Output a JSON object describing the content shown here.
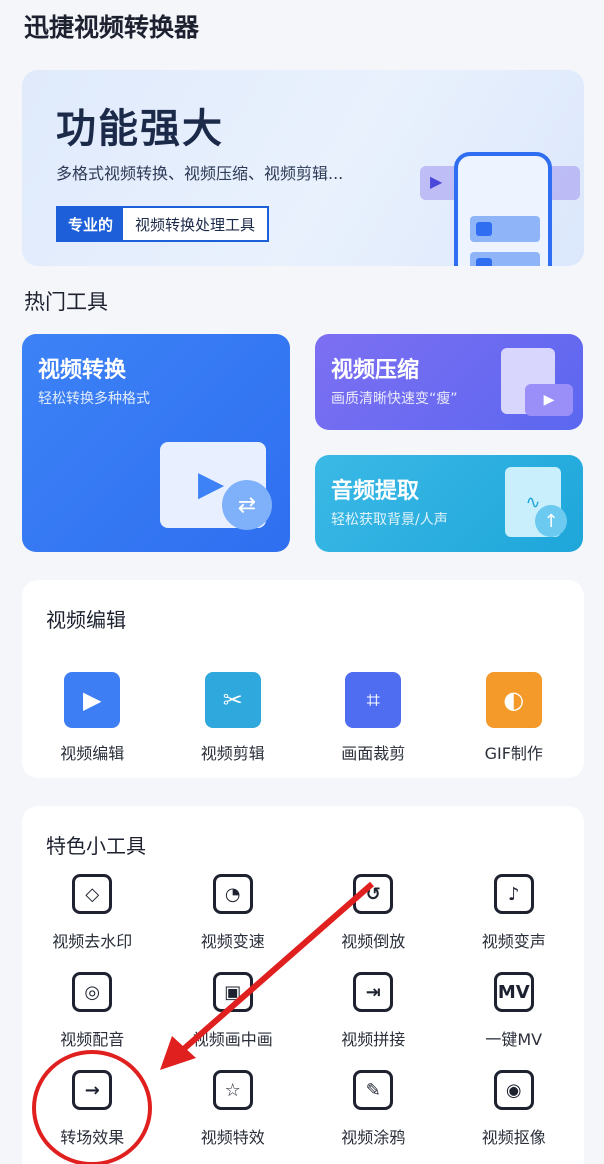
{
  "app": {
    "title": "迅捷视频转换器"
  },
  "banner": {
    "headline": "功能强大",
    "subtitle": "多格式视频转换、视频压缩、视频剪辑...",
    "tag_highlight": "专业的",
    "tag_text": "视频转换处理工具"
  },
  "hot_tools": {
    "title": "热门工具",
    "convert": {
      "title": "视频转换",
      "subtitle": "轻松转换多种格式"
    },
    "compress": {
      "title": "视频压缩",
      "subtitle": "画质清晰快速变“瘦”"
    },
    "audio": {
      "title": "音频提取",
      "subtitle": "轻松获取背景/人声"
    }
  },
  "video_edit": {
    "title": "视频编辑",
    "items": [
      {
        "label": "视频编辑",
        "icon": "video-edit-icon",
        "color": "#3d7ef5"
      },
      {
        "label": "视频剪辑",
        "icon": "scissors-icon",
        "color": "#2fa9dd"
      },
      {
        "label": "画面裁剪",
        "icon": "crop-icon",
        "color": "#4f6df0"
      },
      {
        "label": "GIF制作",
        "icon": "gif-icon",
        "color": "#f39a2a"
      }
    ]
  },
  "special_tools": {
    "title": "特色小工具",
    "items": [
      {
        "label": "视频去水印",
        "icon": "eraser-icon",
        "glyph": "◇"
      },
      {
        "label": "视频变速",
        "icon": "speedometer-icon",
        "glyph": "◔"
      },
      {
        "label": "视频倒放",
        "icon": "rewind-icon",
        "glyph": "↺"
      },
      {
        "label": "视频变声",
        "icon": "voice-change-icon",
        "glyph": "♪"
      },
      {
        "label": "视频配音",
        "icon": "dubbing-icon",
        "glyph": "◎"
      },
      {
        "label": "视频画中画",
        "icon": "picture-in-picture-icon",
        "glyph": "▣"
      },
      {
        "label": "视频拼接",
        "icon": "merge-icon",
        "glyph": "⇥"
      },
      {
        "label": "一键MV",
        "icon": "mv-icon",
        "glyph": "MV"
      },
      {
        "label": "转场效果",
        "icon": "transition-icon",
        "glyph": "→"
      },
      {
        "label": "视频特效",
        "icon": "sparkle-star-icon",
        "glyph": "☆"
      },
      {
        "label": "视频涂鸦",
        "icon": "brush-icon",
        "glyph": "✎"
      },
      {
        "label": "视频抠像",
        "icon": "portrait-cutout-icon",
        "glyph": "◉"
      }
    ]
  },
  "annotation": {
    "color": "#e0201e"
  }
}
